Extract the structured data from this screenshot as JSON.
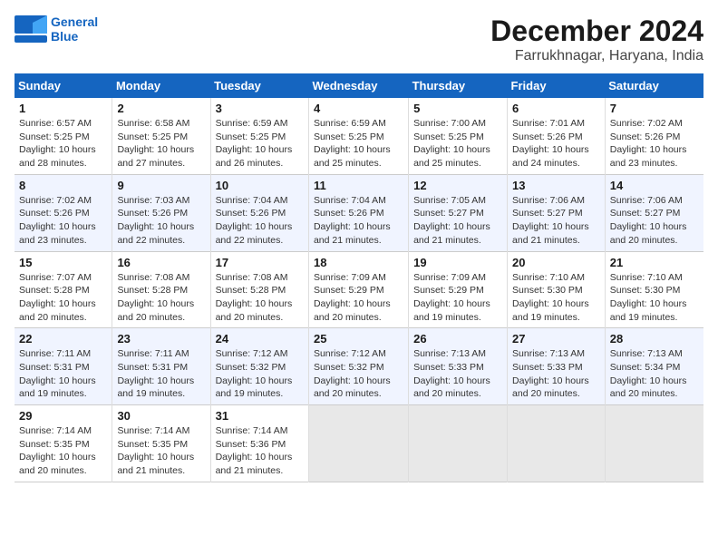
{
  "header": {
    "logo_general": "General",
    "logo_blue": "Blue",
    "month": "December 2024",
    "location": "Farrukhnagar, Haryana, India"
  },
  "days_of_week": [
    "Sunday",
    "Monday",
    "Tuesday",
    "Wednesday",
    "Thursday",
    "Friday",
    "Saturday"
  ],
  "weeks": [
    [
      {
        "day": "1",
        "info": "Sunrise: 6:57 AM\nSunset: 5:25 PM\nDaylight: 10 hours\nand 28 minutes."
      },
      {
        "day": "2",
        "info": "Sunrise: 6:58 AM\nSunset: 5:25 PM\nDaylight: 10 hours\nand 27 minutes."
      },
      {
        "day": "3",
        "info": "Sunrise: 6:59 AM\nSunset: 5:25 PM\nDaylight: 10 hours\nand 26 minutes."
      },
      {
        "day": "4",
        "info": "Sunrise: 6:59 AM\nSunset: 5:25 PM\nDaylight: 10 hours\nand 25 minutes."
      },
      {
        "day": "5",
        "info": "Sunrise: 7:00 AM\nSunset: 5:25 PM\nDaylight: 10 hours\nand 25 minutes."
      },
      {
        "day": "6",
        "info": "Sunrise: 7:01 AM\nSunset: 5:26 PM\nDaylight: 10 hours\nand 24 minutes."
      },
      {
        "day": "7",
        "info": "Sunrise: 7:02 AM\nSunset: 5:26 PM\nDaylight: 10 hours\nand 23 minutes."
      }
    ],
    [
      {
        "day": "8",
        "info": "Sunrise: 7:02 AM\nSunset: 5:26 PM\nDaylight: 10 hours\nand 23 minutes."
      },
      {
        "day": "9",
        "info": "Sunrise: 7:03 AM\nSunset: 5:26 PM\nDaylight: 10 hours\nand 22 minutes."
      },
      {
        "day": "10",
        "info": "Sunrise: 7:04 AM\nSunset: 5:26 PM\nDaylight: 10 hours\nand 22 minutes."
      },
      {
        "day": "11",
        "info": "Sunrise: 7:04 AM\nSunset: 5:26 PM\nDaylight: 10 hours\nand 21 minutes."
      },
      {
        "day": "12",
        "info": "Sunrise: 7:05 AM\nSunset: 5:27 PM\nDaylight: 10 hours\nand 21 minutes."
      },
      {
        "day": "13",
        "info": "Sunrise: 7:06 AM\nSunset: 5:27 PM\nDaylight: 10 hours\nand 21 minutes."
      },
      {
        "day": "14",
        "info": "Sunrise: 7:06 AM\nSunset: 5:27 PM\nDaylight: 10 hours\nand 20 minutes."
      }
    ],
    [
      {
        "day": "15",
        "info": "Sunrise: 7:07 AM\nSunset: 5:28 PM\nDaylight: 10 hours\nand 20 minutes."
      },
      {
        "day": "16",
        "info": "Sunrise: 7:08 AM\nSunset: 5:28 PM\nDaylight: 10 hours\nand 20 minutes."
      },
      {
        "day": "17",
        "info": "Sunrise: 7:08 AM\nSunset: 5:28 PM\nDaylight: 10 hours\nand 20 minutes."
      },
      {
        "day": "18",
        "info": "Sunrise: 7:09 AM\nSunset: 5:29 PM\nDaylight: 10 hours\nand 20 minutes."
      },
      {
        "day": "19",
        "info": "Sunrise: 7:09 AM\nSunset: 5:29 PM\nDaylight: 10 hours\nand 19 minutes."
      },
      {
        "day": "20",
        "info": "Sunrise: 7:10 AM\nSunset: 5:30 PM\nDaylight: 10 hours\nand 19 minutes."
      },
      {
        "day": "21",
        "info": "Sunrise: 7:10 AM\nSunset: 5:30 PM\nDaylight: 10 hours\nand 19 minutes."
      }
    ],
    [
      {
        "day": "22",
        "info": "Sunrise: 7:11 AM\nSunset: 5:31 PM\nDaylight: 10 hours\nand 19 minutes."
      },
      {
        "day": "23",
        "info": "Sunrise: 7:11 AM\nSunset: 5:31 PM\nDaylight: 10 hours\nand 19 minutes."
      },
      {
        "day": "24",
        "info": "Sunrise: 7:12 AM\nSunset: 5:32 PM\nDaylight: 10 hours\nand 19 minutes."
      },
      {
        "day": "25",
        "info": "Sunrise: 7:12 AM\nSunset: 5:32 PM\nDaylight: 10 hours\nand 20 minutes."
      },
      {
        "day": "26",
        "info": "Sunrise: 7:13 AM\nSunset: 5:33 PM\nDaylight: 10 hours\nand 20 minutes."
      },
      {
        "day": "27",
        "info": "Sunrise: 7:13 AM\nSunset: 5:33 PM\nDaylight: 10 hours\nand 20 minutes."
      },
      {
        "day": "28",
        "info": "Sunrise: 7:13 AM\nSunset: 5:34 PM\nDaylight: 10 hours\nand 20 minutes."
      }
    ],
    [
      {
        "day": "29",
        "info": "Sunrise: 7:14 AM\nSunset: 5:35 PM\nDaylight: 10 hours\nand 20 minutes."
      },
      {
        "day": "30",
        "info": "Sunrise: 7:14 AM\nSunset: 5:35 PM\nDaylight: 10 hours\nand 21 minutes."
      },
      {
        "day": "31",
        "info": "Sunrise: 7:14 AM\nSunset: 5:36 PM\nDaylight: 10 hours\nand 21 minutes."
      },
      null,
      null,
      null,
      null
    ]
  ]
}
